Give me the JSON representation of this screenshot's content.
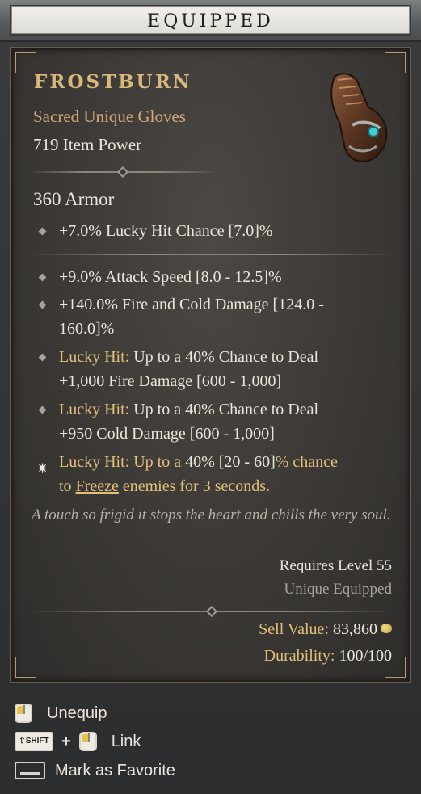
{
  "header": {
    "title": "EQUIPPED"
  },
  "item": {
    "name": "FROSTBURN",
    "type": "Sacred Unique Gloves",
    "power": "719 Item Power",
    "armor": "360 Armor",
    "icon": "gloves-icon"
  },
  "implicit": [
    {
      "text": "+7.0% Lucky Hit Chance [7.0]%"
    }
  ],
  "affixes": [
    {
      "text": "+9.0% Attack Speed [8.0 - 12.5]%"
    },
    {
      "text_line1": "+140.0% Fire and Cold Damage [124.0 -",
      "text_line2": "160.0]%"
    },
    {
      "prefix": "Lucky Hit:",
      "text_line1": " Up to a 40% Chance to Deal",
      "text_line2": "+1,000 Fire Damage [600 - 1,000]"
    },
    {
      "prefix": "Lucky Hit:",
      "text_line1": " Up to a 40% Chance to Deal",
      "text_line2": "+950 Cold Damage [600 - 1,000]"
    }
  ],
  "unique_power": {
    "part1": "Lucky Hit: Up to a ",
    "pct": "40%",
    "range": " [20 - 60]",
    "part2": "% chance",
    "line2_pre": "to ",
    "keyword": "Freeze",
    "line2_post": " enemies for 3 seconds."
  },
  "flavor": "A touch so frigid it stops the heart and chills the very soul.",
  "requirements": {
    "level": "Requires Level 55",
    "unique": "Unique Equipped"
  },
  "stats": {
    "sell_label": "Sell Value:",
    "sell_value": "83,860",
    "durability_label": "Durability:",
    "durability_value": "100/100"
  },
  "footer": {
    "unequip": "Unequip",
    "shift_key": "⇧SHIFT",
    "plus": "+",
    "link": "Link",
    "favorite": "Mark as Favorite"
  },
  "colors": {
    "item_name": "#d9b87c",
    "item_type": "#d4a878",
    "affix_gold": "#e2c17a",
    "flavor": "#b9b2a8"
  }
}
